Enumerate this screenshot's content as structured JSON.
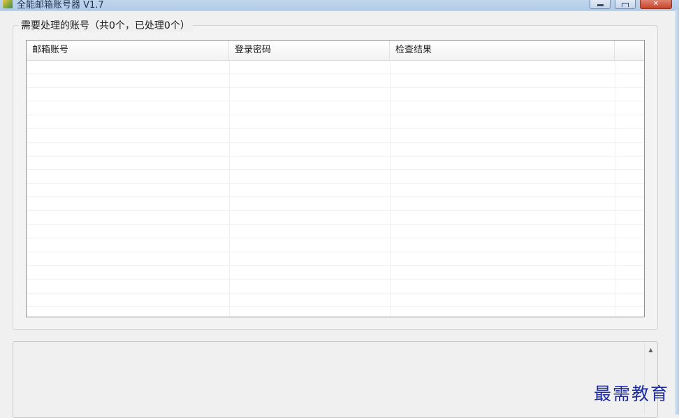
{
  "window": {
    "title": "全能邮箱账号器 V1.7",
    "controls": {
      "minimize": "minimize",
      "maximize": "maximize",
      "close": "✕"
    }
  },
  "accounts_group": {
    "legend": "需要处理的账号（共0个，已处理0个）",
    "total": 0,
    "processed": 0
  },
  "accounts_table": {
    "columns": [
      "邮箱账号",
      "登录密码",
      "检查结果",
      ""
    ],
    "rows": []
  },
  "log": {
    "value": ""
  },
  "watermark": {
    "text": "最需教育"
  }
}
